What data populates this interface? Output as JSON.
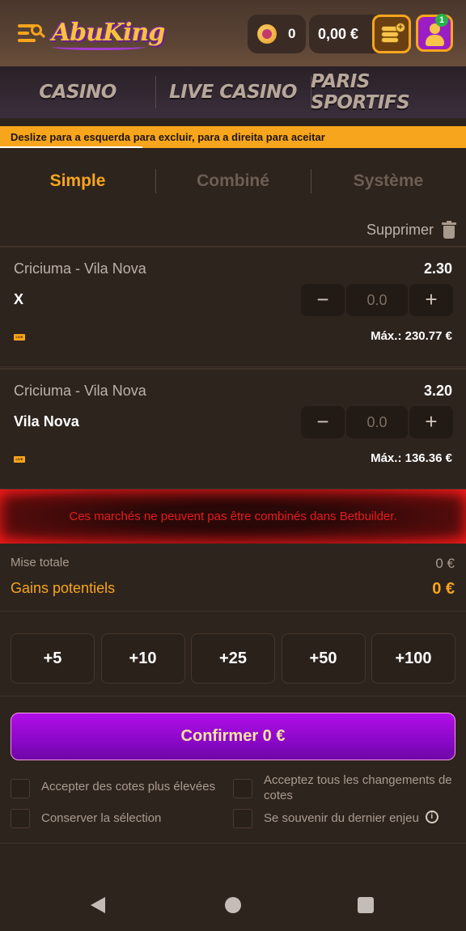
{
  "header": {
    "logo_text": "AbuKing",
    "coins_value": "0",
    "balance": "0,00 €",
    "notification_count": "1"
  },
  "nav": {
    "items": [
      {
        "label": "CASINO"
      },
      {
        "label": "LIVE CASINO"
      },
      {
        "label": "PARIS SPORTIFS"
      }
    ]
  },
  "hint": "Deslize para a esquerda para excluir, para a direita para aceitar",
  "bet_tabs": {
    "items": [
      {
        "label": "Simple",
        "active": true
      },
      {
        "label": "Combiné",
        "active": false
      },
      {
        "label": "Système",
        "active": false
      }
    ]
  },
  "delete_label": "Supprimer",
  "bets": [
    {
      "match": "Criciuma - Vila Nova",
      "odds": "2.30",
      "selection": "X",
      "stake": "0.0",
      "max": "Máx.: 230.77 €",
      "live_label": "LIVE"
    },
    {
      "match": "Criciuma - Vila Nova",
      "odds": "3.20",
      "selection": "Vila Nova",
      "stake": "0.0",
      "max": "Máx.: 136.36 €",
      "live_label": "LIVE"
    }
  ],
  "stepper": {
    "minus": "−",
    "plus": "+"
  },
  "error": "Ces marchés ne peuvent pas être combinés dans Betbuilder.",
  "totals": {
    "total_stake_label": "Mise totale",
    "total_stake_value": "0 €",
    "potential_label": "Gains potentiels",
    "potential_value": "0 €"
  },
  "quick_stakes": [
    "+5",
    "+10",
    "+25",
    "+50",
    "+100"
  ],
  "confirm_label": "Confirmer 0 €",
  "options": [
    {
      "label": "Accepter des cotes plus élevées"
    },
    {
      "label": "Acceptez tous les changements de cotes"
    },
    {
      "label": "Conserver la sélection"
    },
    {
      "label": "Se souvenir du dernier enjeu"
    }
  ],
  "colors": {
    "accent": "#f7a51c",
    "confirm": "#a00cdc",
    "error": "#e81c1c",
    "background": "#2e241e"
  }
}
